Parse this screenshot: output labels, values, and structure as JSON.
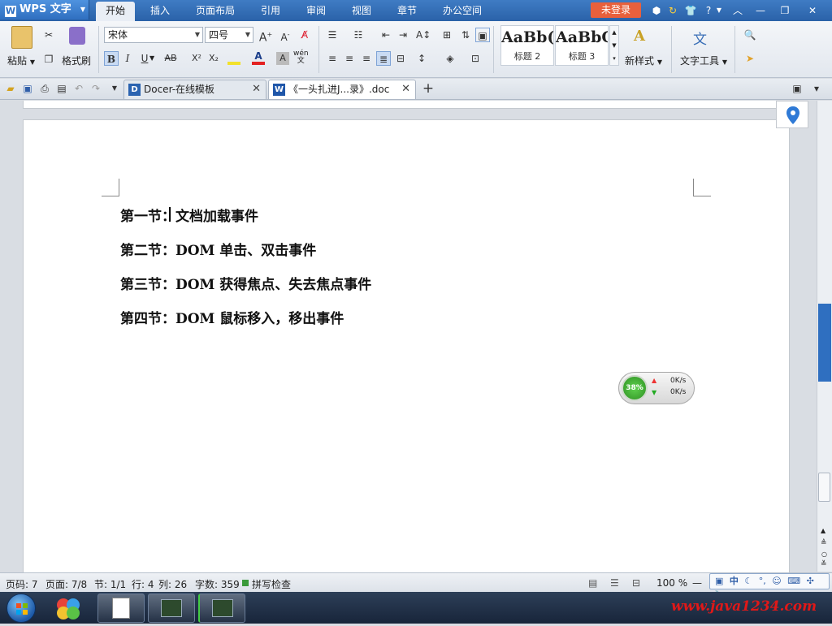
{
  "app": {
    "menu_label": "WPS 文字",
    "menu_tabs": [
      "开始",
      "插入",
      "页面布局",
      "引用",
      "审阅",
      "视图",
      "章节",
      "办公空间"
    ],
    "active_tab_index": 0,
    "login_label": "未登录"
  },
  "ribbon": {
    "paste_label": "粘贴",
    "format_painter_label": "格式刷",
    "font_name": "宋体",
    "font_size": "四号",
    "bold_label": "B",
    "italic_label": "I",
    "underline_label": "U",
    "strike_label": "AB",
    "superscript_label": "X²",
    "subscript_label": "X₂",
    "styles": [
      {
        "preview": "AaBb(",
        "caption": "标题 2"
      },
      {
        "preview": "AaBbC",
        "caption": "标题 3"
      }
    ],
    "new_style_label": "新样式",
    "text_tools_label": "文字工具"
  },
  "tabs": [
    {
      "label": "Docer-在线模板",
      "icon": "docer-icon"
    },
    {
      "label": "《一头扎进J...录》.doc",
      "icon": "word-doc-icon"
    }
  ],
  "document": {
    "paragraphs": [
      "第一节：文档加载事件",
      "第二节：DOM 单击、双击事件",
      "第三节：DOM 获得焦点、失去焦点事件",
      "第四节：DOM 鼠标移入，移出事件"
    ]
  },
  "speed_widget": {
    "percent": "38%",
    "up": "0K/s",
    "down": "0K/s"
  },
  "status": {
    "page_num": "页码: 7",
    "page": "页面: 7/8",
    "section": "节: 1/1",
    "line": "行: 4",
    "column": "列: 26",
    "word_count": "字数: 359",
    "spell_check": "拼写检查",
    "zoom": "100 %"
  },
  "ime_bar": {
    "mode": "中"
  },
  "watermark": "www.java1234.com",
  "colors": {
    "title_bar": "#2f6fc0",
    "login": "#e8603c",
    "location_pin": "#2f7ad6",
    "speed_ring": "#3ea832"
  }
}
